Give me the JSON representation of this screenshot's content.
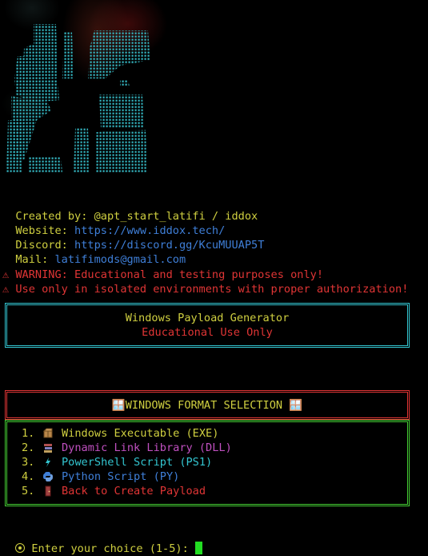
{
  "credits": {
    "created_label": "Created by:",
    "created_value": "@apt_start_latifi / iddox",
    "website_label": "Website:",
    "website_value": "https://www.iddox.tech/",
    "discord_label": "Discord:",
    "discord_value": "https://discord.gg/KcuMUUAP5T",
    "mail_label": "Mail:",
    "mail_value": "latifimods@gmail.com"
  },
  "warnings": [
    "⚠ WARNING: Educational and testing purposes only!",
    "⚠ Use only in isolated environments with proper authorization!"
  ],
  "header": {
    "title": "Windows Payload Generator",
    "subtitle": "Educational Use Only"
  },
  "selection": {
    "title": "🪟WINDOWS FORMAT SELECTION 🪟"
  },
  "menu": [
    {
      "number": "1.",
      "label": "Windows Executable (EXE)",
      "icon": "package-icon",
      "color": "#cfcf40"
    },
    {
      "number": "2.",
      "label": "Dynamic Link Library (DLL)",
      "icon": "books-icon",
      "color": "#c050c0"
    },
    {
      "number": "3.",
      "label": "PowerShell Script (PS1)",
      "icon": "lightning-icon",
      "color": "#33c5d0"
    },
    {
      "number": "4.",
      "label": "Python Script (PY)",
      "icon": "python-icon",
      "color": "#3f7fd8"
    },
    {
      "number": "5.",
      "label": "Back to Create Payload",
      "icon": "door-icon",
      "color": "#e03535"
    }
  ],
  "prompt": {
    "text": "Enter your choice (1-5):"
  },
  "colors": {
    "yellow": "#cfcf40",
    "blue": "#3f7fd8",
    "red": "#e03535",
    "cyan": "#33c5d0",
    "green": "#44cc33",
    "magenta": "#c050c0"
  }
}
